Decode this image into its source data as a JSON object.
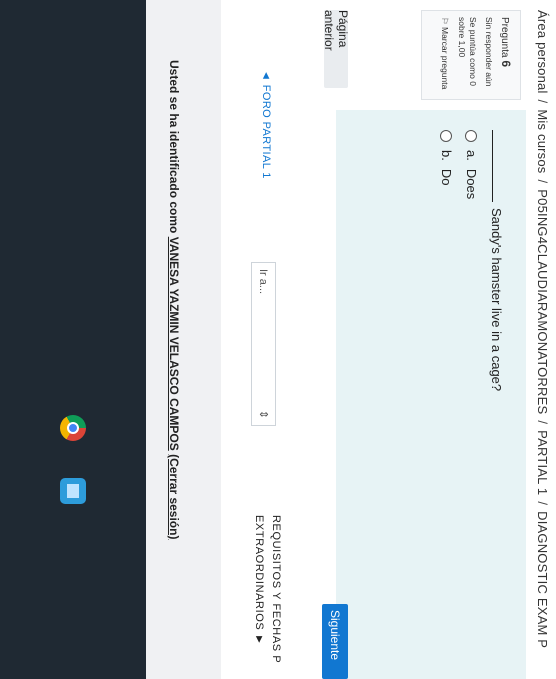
{
  "breadcrumb": {
    "items": [
      "Área personal",
      "Mis cursos",
      "P05ING4CLAUDIARAMONATORRES",
      "PARTIAL 1",
      "DIAGNOSTIC EXAM P"
    ],
    "separator": "/"
  },
  "question_info": {
    "label": "Pregunta",
    "number": "6",
    "status": "Sin responder aún",
    "mark": "Se puntúa como 0 sobre 1,00",
    "flag_label": "Marcar pregunta"
  },
  "question": {
    "text": "Sandy's hamster live in a cage?",
    "options": [
      {
        "letter": "a.",
        "label": "Does"
      },
      {
        "letter": "b.",
        "label": "Do"
      }
    ]
  },
  "nav": {
    "prev_button": "Página anterior",
    "next_button": "Siguiente",
    "prev_activity": "◄ FORO PARTIAL 1",
    "goto_placeholder": "Ir a...",
    "next_activity_line1": "REQUISITOS Y FECHAS P",
    "next_activity_line2": "EXTRAORDINARIOS ►"
  },
  "footer": {
    "prefix": "Usted se ha identificado como",
    "user": "VANESA YAZMIN VELASCO CAMPOS",
    "logout": "(Cerrar sesión)"
  },
  "taskbar": {
    "icons": [
      "chrome-icon",
      "files-icon"
    ]
  }
}
